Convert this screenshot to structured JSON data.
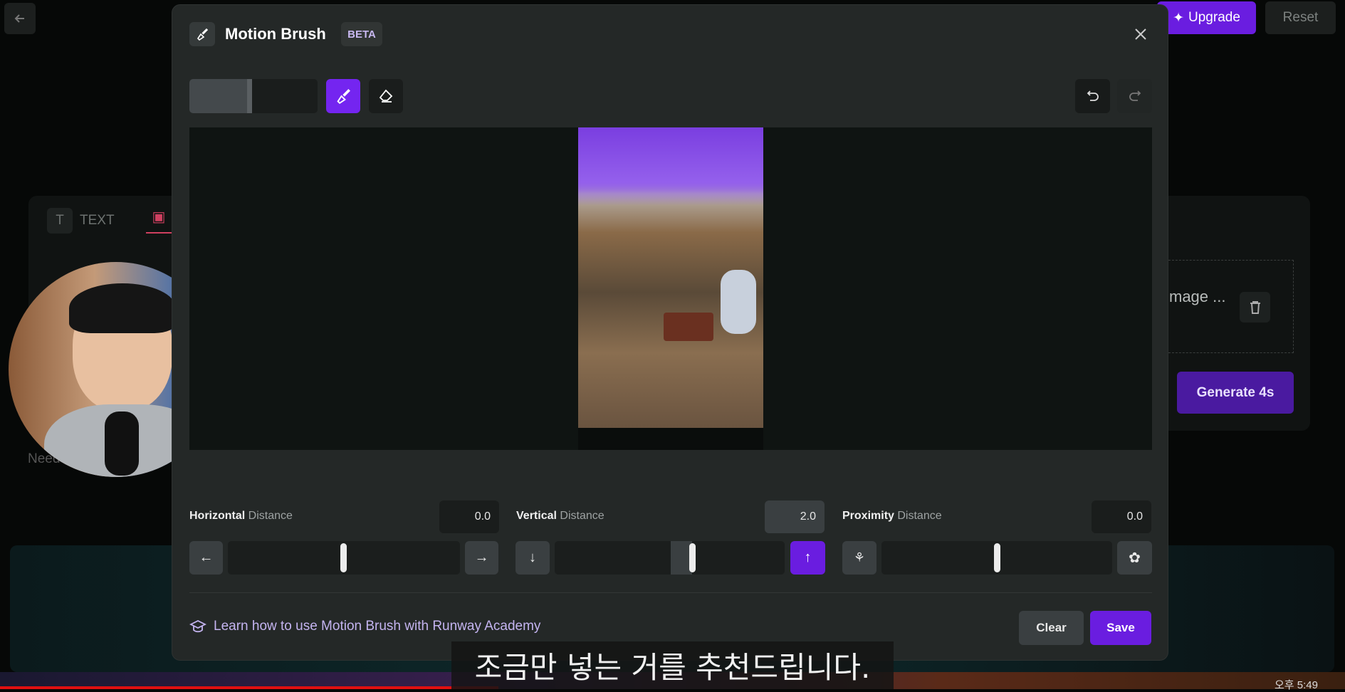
{
  "background": {
    "upgrade_label": "Upgrade",
    "reset_label": "Reset",
    "text_tab_label": "TEXT",
    "image_name_truncated": "mage ...",
    "generate_label": "Generate 4s",
    "need_text": "Need",
    "clock": "오후 5:49"
  },
  "modal": {
    "title": "Motion Brush",
    "badge": "BETA",
    "brush_size_fraction": 0.48,
    "controls": [
      {
        "name": "Horizontal",
        "suffix": "Distance",
        "value": "0.0"
      },
      {
        "name": "Vertical",
        "suffix": "Distance",
        "value": "2.0"
      },
      {
        "name": "Proximity",
        "suffix": "Distance",
        "value": "0.0"
      }
    ],
    "learn_link": "Learn how to use Motion Brush with Runway Academy",
    "clear_label": "Clear",
    "save_label": "Save",
    "accent": "#6a1de0"
  },
  "subtitle": "조금만 넣는 거를 추천드립니다."
}
